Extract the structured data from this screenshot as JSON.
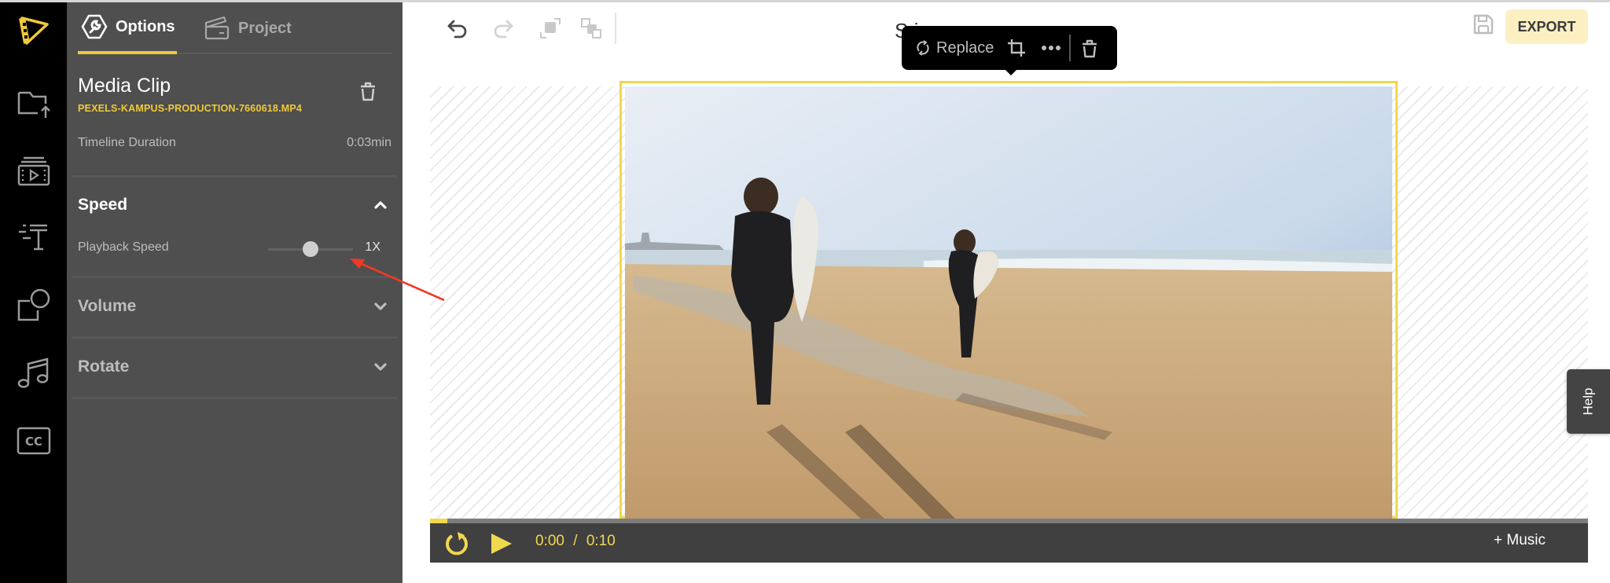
{
  "rail": {
    "items": [
      {
        "name": "logo",
        "icon": "app-logo-icon"
      },
      {
        "name": "media-upload",
        "icon": "folder-upload-icon"
      },
      {
        "name": "media-library",
        "icon": "video-library-icon"
      },
      {
        "name": "text",
        "icon": "text-icon"
      },
      {
        "name": "elements",
        "icon": "shapes-icon"
      },
      {
        "name": "audio",
        "icon": "music-icon"
      },
      {
        "name": "subtitles",
        "icon": "closed-captions-icon"
      }
    ]
  },
  "panel": {
    "tabs": [
      {
        "label": "Options",
        "active": true
      },
      {
        "label": "Project",
        "active": false
      }
    ],
    "clip": {
      "title": "Media Clip",
      "filename": "PEXELS-KAMPUS-PRODUCTION-7660618.MP4",
      "duration_label": "Timeline Duration",
      "duration_value": "0:03min"
    },
    "sections": {
      "speed": {
        "title": "Speed",
        "expanded": true,
        "playback_label": "Playback Speed",
        "playback_value": "1X",
        "slider_fraction": 0.5
      },
      "volume": {
        "title": "Volume",
        "expanded": false
      },
      "rotate": {
        "title": "Rotate",
        "expanded": false
      }
    }
  },
  "toolbar": {
    "undo": "undo-icon",
    "redo": "redo-icon",
    "bring_forward": "bring-forward-icon",
    "send_backward": "send-backward-icon",
    "project_title_visible": "S                     i",
    "export_label": "EXPORT"
  },
  "context_menu": {
    "replace_label": "Replace",
    "crop": "crop-icon",
    "more": "more-icon",
    "delete": "trash-icon"
  },
  "player": {
    "current_time": "0:00",
    "separator": "/",
    "total_time": "0:10",
    "progress_fraction": 0.015,
    "music_label": "+ Music"
  },
  "help": {
    "label": "Help"
  },
  "colors": {
    "accent": "#f0d84e",
    "filename": "#f0c93a",
    "panel_bg": "#4f4f4f",
    "rail_bg": "#000000",
    "export_bg": "#fcf0c3",
    "player_bg": "#404040",
    "annotation_arrow": "#f03a26"
  }
}
